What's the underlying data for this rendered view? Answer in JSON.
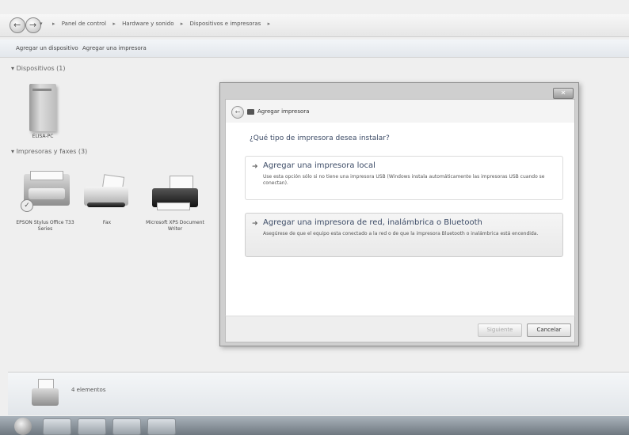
{
  "address_bar": {
    "crumbs": [
      "Panel de control",
      "Hardware y sonido",
      "Dispositivos e impresoras"
    ]
  },
  "toolbar": {
    "add_device": "Agregar un dispositivo",
    "add_printer": "Agregar una impresora"
  },
  "sections": {
    "devices": "Dispositivos (1)",
    "printers": "Impresoras y faxes (3)"
  },
  "devices": [
    {
      "label": "ELISA-PC"
    }
  ],
  "printers": [
    {
      "label": "EPSON Stylus Office T33 Series"
    },
    {
      "label": "Fax"
    },
    {
      "label": "Microsoft XPS Document Writer"
    }
  ],
  "dialog": {
    "title": "Agregar impresora",
    "question": "¿Qué tipo de impresora desea instalar?",
    "options": [
      {
        "title": "Agregar una impresora local",
        "description": "Use esta opción sólo si no tiene una impresora USB (Windows instala automáticamente las impresoras USB cuando se conectan)."
      },
      {
        "title": "Agregar una impresora de red, inalámbrica o Bluetooth",
        "description": "Asegúrese de que el equipo esta conectado a la red o de que la impresora Bluetooth o inalámbrica está encendida."
      }
    ],
    "next_button": "Siguiente",
    "cancel_button": "Cancelar"
  },
  "details": {
    "count": "4 elementos"
  }
}
